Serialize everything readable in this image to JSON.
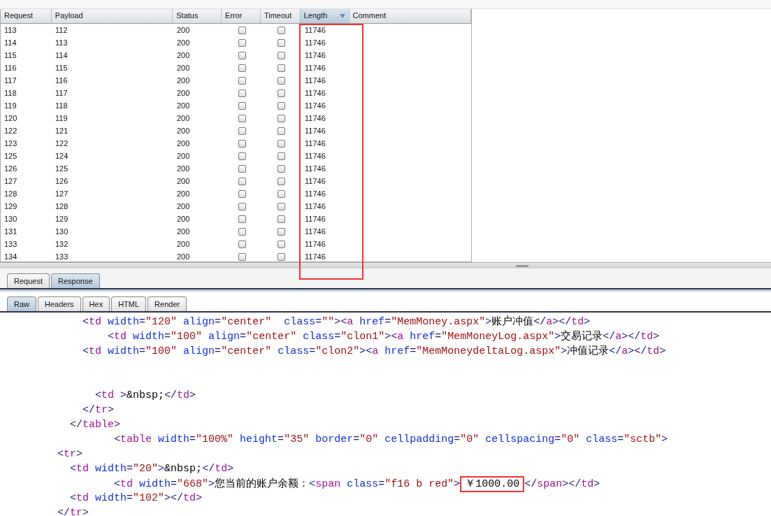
{
  "results_table": {
    "columns": [
      {
        "label": "Request",
        "sorted": false
      },
      {
        "label": "Payload",
        "sorted": false
      },
      {
        "label": "Status",
        "sorted": false
      },
      {
        "label": "Error",
        "sorted": false
      },
      {
        "label": "Timeout",
        "sorted": false
      },
      {
        "label": "Length",
        "sorted": true,
        "highlighted": true
      },
      {
        "label": "Comment",
        "sorted": false
      }
    ],
    "rows": [
      {
        "request": "113",
        "payload": "112",
        "status": "200",
        "error": false,
        "timeout": false,
        "length": "11746"
      },
      {
        "request": "114",
        "payload": "113",
        "status": "200",
        "error": false,
        "timeout": false,
        "length": "11746"
      },
      {
        "request": "115",
        "payload": "114",
        "status": "200",
        "error": false,
        "timeout": false,
        "length": "11746"
      },
      {
        "request": "116",
        "payload": "115",
        "status": "200",
        "error": false,
        "timeout": false,
        "length": "11746"
      },
      {
        "request": "117",
        "payload": "116",
        "status": "200",
        "error": false,
        "timeout": false,
        "length": "11746"
      },
      {
        "request": "118",
        "payload": "117",
        "status": "200",
        "error": false,
        "timeout": false,
        "length": "11746"
      },
      {
        "request": "119",
        "payload": "118",
        "status": "200",
        "error": false,
        "timeout": false,
        "length": "11746"
      },
      {
        "request": "120",
        "payload": "119",
        "status": "200",
        "error": false,
        "timeout": false,
        "length": "11746"
      },
      {
        "request": "122",
        "payload": "121",
        "status": "200",
        "error": false,
        "timeout": false,
        "length": "11746"
      },
      {
        "request": "123",
        "payload": "122",
        "status": "200",
        "error": false,
        "timeout": false,
        "length": "11746"
      },
      {
        "request": "125",
        "payload": "124",
        "status": "200",
        "error": false,
        "timeout": false,
        "length": "11746"
      },
      {
        "request": "126",
        "payload": "125",
        "status": "200",
        "error": false,
        "timeout": false,
        "length": "11746"
      },
      {
        "request": "127",
        "payload": "126",
        "status": "200",
        "error": false,
        "timeout": false,
        "length": "11746"
      },
      {
        "request": "128",
        "payload": "127",
        "status": "200",
        "error": false,
        "timeout": false,
        "length": "11746"
      },
      {
        "request": "129",
        "payload": "128",
        "status": "200",
        "error": false,
        "timeout": false,
        "length": "11746"
      },
      {
        "request": "130",
        "payload": "129",
        "status": "200",
        "error": false,
        "timeout": false,
        "length": "11746"
      },
      {
        "request": "131",
        "payload": "130",
        "status": "200",
        "error": false,
        "timeout": false,
        "length": "11746"
      },
      {
        "request": "133",
        "payload": "132",
        "status": "200",
        "error": false,
        "timeout": false,
        "length": "11746"
      },
      {
        "request": "134",
        "payload": "133",
        "status": "200",
        "error": false,
        "timeout": false,
        "length": "11746"
      }
    ]
  },
  "message_tabs": [
    {
      "label": "Request",
      "selected": false
    },
    {
      "label": "Response",
      "selected": true
    }
  ],
  "view_tabs": [
    {
      "label": "Raw",
      "selected": true
    },
    {
      "label": "Headers",
      "selected": false
    },
    {
      "label": "Hex",
      "selected": false
    },
    {
      "label": "HTML",
      "selected": false
    },
    {
      "label": "Render",
      "selected": false
    }
  ],
  "code_lines": [
    {
      "kind": "code",
      "tokens": [
        {
          "kind": "punct",
          "text": "            <"
        },
        {
          "kind": "tag",
          "text": "td"
        },
        {
          "kind": "attr",
          "text": " width"
        },
        {
          "kind": "punct",
          "text": "="
        },
        {
          "kind": "value",
          "text": "\"120\""
        },
        {
          "kind": "attr",
          "text": " align"
        },
        {
          "kind": "punct",
          "text": "="
        },
        {
          "kind": "value",
          "text": "\"center\""
        },
        {
          "kind": "attr",
          "text": "  class"
        },
        {
          "kind": "punct",
          "text": "="
        },
        {
          "kind": "value",
          "text": "\"\""
        },
        {
          "kind": "punct",
          "text": "><"
        },
        {
          "kind": "tag",
          "text": "a"
        },
        {
          "kind": "attr",
          "text": " href"
        },
        {
          "kind": "punct",
          "text": "="
        },
        {
          "kind": "value",
          "text": "\"MemMoney.aspx\""
        },
        {
          "kind": "punct",
          "text": ">"
        },
        {
          "kind": "text",
          "text": "账户冲值"
        },
        {
          "kind": "punct",
          "text": "</"
        },
        {
          "kind": "tag",
          "text": "a"
        },
        {
          "kind": "punct",
          "text": "></"
        },
        {
          "kind": "tag",
          "text": "td"
        },
        {
          "kind": "punct",
          "text": ">"
        }
      ]
    },
    {
      "kind": "code",
      "tokens": [
        {
          "kind": "punct",
          "text": "                <"
        },
        {
          "kind": "tag",
          "text": "td"
        },
        {
          "kind": "attr",
          "text": " width"
        },
        {
          "kind": "punct",
          "text": "="
        },
        {
          "kind": "value",
          "text": "\"100\""
        },
        {
          "kind": "attr",
          "text": " align"
        },
        {
          "kind": "punct",
          "text": "="
        },
        {
          "kind": "value",
          "text": "\"center\""
        },
        {
          "kind": "attr",
          "text": " class"
        },
        {
          "kind": "punct",
          "text": "="
        },
        {
          "kind": "value",
          "text": "\"clon1\""
        },
        {
          "kind": "punct",
          "text": "><"
        },
        {
          "kind": "tag",
          "text": "a"
        },
        {
          "kind": "attr",
          "text": " href"
        },
        {
          "kind": "punct",
          "text": "="
        },
        {
          "kind": "value",
          "text": "\"MemMoneyLog.aspx\""
        },
        {
          "kind": "punct",
          "text": ">"
        },
        {
          "kind": "text",
          "text": "交易记录"
        },
        {
          "kind": "punct",
          "text": "</"
        },
        {
          "kind": "tag",
          "text": "a"
        },
        {
          "kind": "punct",
          "text": "></"
        },
        {
          "kind": "tag",
          "text": "td"
        },
        {
          "kind": "punct",
          "text": ">"
        }
      ]
    },
    {
      "kind": "code",
      "tokens": [
        {
          "kind": "punct",
          "text": "            <"
        },
        {
          "kind": "tag",
          "text": "td"
        },
        {
          "kind": "attr",
          "text": " width"
        },
        {
          "kind": "punct",
          "text": "="
        },
        {
          "kind": "value",
          "text": "\"100\""
        },
        {
          "kind": "attr",
          "text": " align"
        },
        {
          "kind": "punct",
          "text": "="
        },
        {
          "kind": "value",
          "text": "\"center\""
        },
        {
          "kind": "attr",
          "text": " class"
        },
        {
          "kind": "punct",
          "text": "="
        },
        {
          "kind": "value",
          "text": "\"clon2\""
        },
        {
          "kind": "punct",
          "text": "><"
        },
        {
          "kind": "tag",
          "text": "a"
        },
        {
          "kind": "attr",
          "text": " href"
        },
        {
          "kind": "punct",
          "text": "="
        },
        {
          "kind": "value",
          "text": "\"MemMoneydeltaLog.aspx\""
        },
        {
          "kind": "punct",
          "text": ">"
        },
        {
          "kind": "text",
          "text": "冲值记录"
        },
        {
          "kind": "punct",
          "text": "</"
        },
        {
          "kind": "tag",
          "text": "a"
        },
        {
          "kind": "punct",
          "text": "></"
        },
        {
          "kind": "tag",
          "text": "td"
        },
        {
          "kind": "punct",
          "text": ">"
        }
      ]
    },
    {
      "kind": "blank"
    },
    {
      "kind": "blank"
    },
    {
      "kind": "code",
      "tokens": [
        {
          "kind": "punct",
          "text": "              <"
        },
        {
          "kind": "tag",
          "text": "td"
        },
        {
          "kind": "punct",
          "text": " >"
        },
        {
          "kind": "text",
          "text": "&nbsp;"
        },
        {
          "kind": "punct",
          "text": "</"
        },
        {
          "kind": "tag",
          "text": "td"
        },
        {
          "kind": "punct",
          "text": ">"
        }
      ]
    },
    {
      "kind": "code",
      "tokens": [
        {
          "kind": "punct",
          "text": "            </"
        },
        {
          "kind": "tag",
          "text": "tr"
        },
        {
          "kind": "punct",
          "text": ">"
        }
      ]
    },
    {
      "kind": "code",
      "tokens": [
        {
          "kind": "punct",
          "text": "          </"
        },
        {
          "kind": "tag",
          "text": "table"
        },
        {
          "kind": "punct",
          "text": ">"
        }
      ]
    },
    {
      "kind": "code",
      "tokens": [
        {
          "kind": "punct",
          "text": "                 <"
        },
        {
          "kind": "tag",
          "text": "table"
        },
        {
          "kind": "attr",
          "text": " width"
        },
        {
          "kind": "punct",
          "text": "="
        },
        {
          "kind": "value",
          "text": "\"100%\""
        },
        {
          "kind": "attr",
          "text": " height"
        },
        {
          "kind": "punct",
          "text": "="
        },
        {
          "kind": "value",
          "text": "\"35\""
        },
        {
          "kind": "attr",
          "text": " border"
        },
        {
          "kind": "punct",
          "text": "="
        },
        {
          "kind": "value",
          "text": "\"0\""
        },
        {
          "kind": "attr",
          "text": " cellpadding"
        },
        {
          "kind": "punct",
          "text": "="
        },
        {
          "kind": "value",
          "text": "\"0\""
        },
        {
          "kind": "attr",
          "text": " cellspacing"
        },
        {
          "kind": "punct",
          "text": "="
        },
        {
          "kind": "value",
          "text": "\"0\""
        },
        {
          "kind": "attr",
          "text": " class"
        },
        {
          "kind": "punct",
          "text": "="
        },
        {
          "kind": "value",
          "text": "\"sctb\""
        },
        {
          "kind": "punct",
          "text": ">"
        }
      ]
    },
    {
      "kind": "code",
      "tokens": [
        {
          "kind": "punct",
          "text": "        <"
        },
        {
          "kind": "tag",
          "text": "tr"
        },
        {
          "kind": "punct",
          "text": ">"
        }
      ]
    },
    {
      "kind": "code",
      "tokens": [
        {
          "kind": "punct",
          "text": "          <"
        },
        {
          "kind": "tag",
          "text": "td"
        },
        {
          "kind": "attr",
          "text": " width"
        },
        {
          "kind": "punct",
          "text": "="
        },
        {
          "kind": "value",
          "text": "\"20\""
        },
        {
          "kind": "punct",
          "text": ">"
        },
        {
          "kind": "text",
          "text": "&nbsp;"
        },
        {
          "kind": "punct",
          "text": "</"
        },
        {
          "kind": "tag",
          "text": "td"
        },
        {
          "kind": "punct",
          "text": ">"
        }
      ]
    },
    {
      "kind": "code",
      "tokens": [
        {
          "kind": "punct",
          "text": "                 <"
        },
        {
          "kind": "tag",
          "text": "td"
        },
        {
          "kind": "attr",
          "text": " width"
        },
        {
          "kind": "punct",
          "text": "="
        },
        {
          "kind": "value",
          "text": "\"668\""
        },
        {
          "kind": "punct",
          "text": ">"
        },
        {
          "kind": "text",
          "text": "您当前的账户余额："
        },
        {
          "kind": "punct",
          "text": "<"
        },
        {
          "kind": "tag",
          "text": "span"
        },
        {
          "kind": "attr",
          "text": " class"
        },
        {
          "kind": "punct",
          "text": "="
        },
        {
          "kind": "value",
          "text": "\"f16 b red\""
        },
        {
          "kind": "punct",
          "text": ">"
        },
        {
          "kind": "text",
          "text": "￥1000.00",
          "highlighted": true
        },
        {
          "kind": "punct",
          "text": "</"
        },
        {
          "kind": "tag",
          "text": "span"
        },
        {
          "kind": "punct",
          "text": "></"
        },
        {
          "kind": "tag",
          "text": "td"
        },
        {
          "kind": "punct",
          "text": ">"
        }
      ]
    },
    {
      "kind": "code",
      "tokens": [
        {
          "kind": "punct",
          "text": "          <"
        },
        {
          "kind": "tag",
          "text": "td"
        },
        {
          "kind": "attr",
          "text": " width"
        },
        {
          "kind": "punct",
          "text": "="
        },
        {
          "kind": "value",
          "text": "\"102\""
        },
        {
          "kind": "punct",
          "text": "></"
        },
        {
          "kind": "tag",
          "text": "td"
        },
        {
          "kind": "punct",
          "text": ">"
        }
      ]
    },
    {
      "kind": "code",
      "tokens": [
        {
          "kind": "punct",
          "text": "        </"
        },
        {
          "kind": "tag",
          "text": "tr"
        },
        {
          "kind": "punct",
          "text": ">"
        }
      ]
    }
  ]
}
